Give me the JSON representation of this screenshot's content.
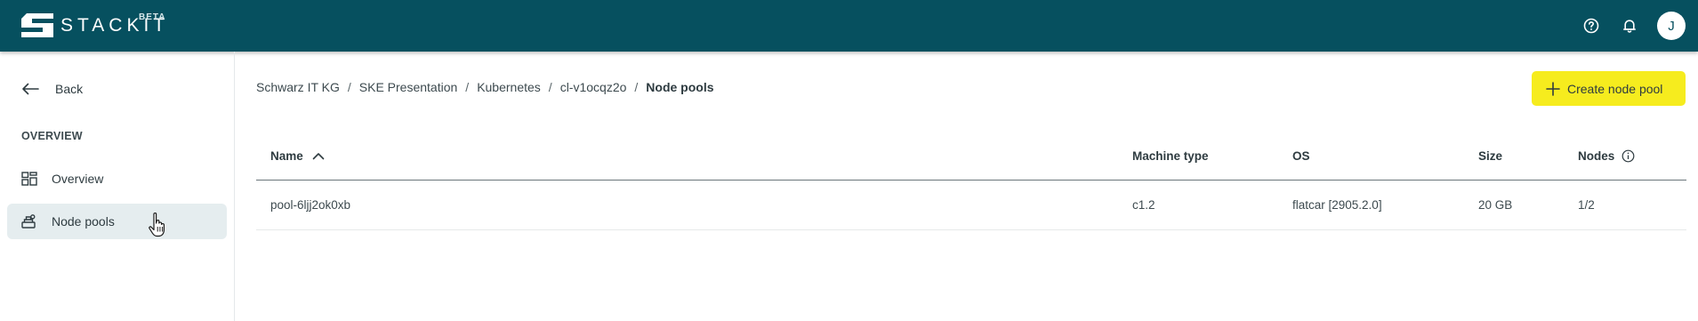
{
  "brand": {
    "logo_text": "STACKIT",
    "beta": "BETA"
  },
  "topbar": {
    "help_icon": "help-icon",
    "bell_icon": "bell-icon",
    "avatar_initial": "J"
  },
  "sidebar": {
    "back_label": "Back",
    "section_label": "OVERVIEW",
    "items": [
      {
        "label": "Overview",
        "icon": "dashboard-icon",
        "active": false
      },
      {
        "label": "Node pools",
        "icon": "node-pool-icon",
        "active": true
      }
    ]
  },
  "breadcrumb": [
    {
      "label": "Schwarz IT KG"
    },
    {
      "label": "SKE Presentation"
    },
    {
      "label": "Kubernetes"
    },
    {
      "label": "cl-v1ocqz2o"
    },
    {
      "label": "Node pools"
    }
  ],
  "actions": {
    "create_label": "Create node pool"
  },
  "table": {
    "headers": [
      "Name",
      "Machine type",
      "OS",
      "Size",
      "Nodes"
    ],
    "sort": {
      "column": "Name",
      "direction": "ascending"
    },
    "rows": [
      {
        "name": "pool-6ljj2ok0xb",
        "machine_type": "c1.2",
        "os": "flatcar [2905.2.0]",
        "size": "20 GB",
        "nodes": "1/2"
      }
    ]
  },
  "colors": {
    "topbar": "#06505f",
    "accent_button": "#f6ec1e",
    "active_nav": "#e5edef"
  }
}
